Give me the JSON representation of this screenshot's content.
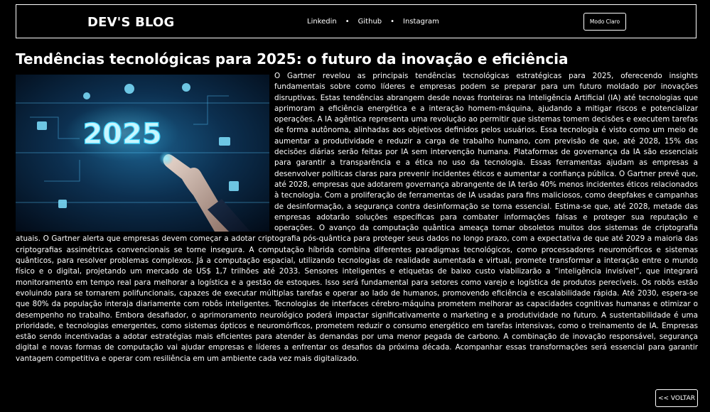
{
  "header": {
    "brand": "DEV'S BLOG",
    "nav": {
      "linkedin": "Linkedin",
      "github": "Github",
      "instagram": "Instagram",
      "separator": "•"
    },
    "mode_button": "Modo Claro"
  },
  "article": {
    "title": "Tendências tecnológicas para 2025: o futuro da inovação e eficiência",
    "image_text": "2025",
    "body": "O Gartner revelou as principais tendências tecnológicas estratégicas para 2025, oferecendo insights fundamentais sobre como líderes e empresas podem se preparar para um futuro moldado por inovações disruptivas. Estas tendências abrangem desde novas fronteiras na Inteligência Artificial (IA) até tecnologias que aprimoram a eficiência energética e a interação homem-máquina, ajudando a mitigar riscos e potencializar operações. A IA agêntica representa uma revolução ao permitir que sistemas tomem decisões e executem tarefas de forma autônoma, alinhadas aos objetivos definidos pelos usuários. Essa tecnologia é visto como um meio de aumentar a produtividade e reduzir a carga de trabalho humano, com previsão de que, até 2028, 15% das decisões diárias serão feitas por IA sem intervenção humana. Plataformas de governança da IA são essenciais para garantir a transparência e a ética no uso da tecnologia. Essas ferramentas ajudam as empresas a desenvolver políticas claras para prevenir incidentes éticos e aumentar a confiança pública. O Gartner prevê que, até 2028, empresas que adotarem governança abrangente de IA terão 40% menos incidentes éticos relacionados à tecnologia. Com a proliferação de ferramentas de IA usadas para fins maliciosos, como deepfakes e campanhas de desinformação, a segurança contra desinformação se torna essencial. Estima-se que, até 2028, metade das empresas adotarão soluções específicas para combater informações falsas e proteger sua reputação e operações. O avanço da computação quântica ameaça tornar obsoletos muitos dos sistemas de criptografia atuais. O Gartner alerta que empresas devem começar a adotar criptografia pós-quântica para proteger seus dados no longo prazo, com a expectativa de que até 2029 a maioria das criptografias assimétricas convencionais se torne insegura. A computação híbrida combina diferentes paradigmas tecnológicos, como processadores neuromórficos e sistemas quânticos, para resolver problemas complexos. Já a computação espacial, utilizando tecnologias de realidade aumentada e virtual, promete transformar a interação entre o mundo físico e o digital, projetando um mercado de US$ 1,7 trilhões até 2033. Sensores inteligentes e etiquetas de baixo custo viabilizarão a “inteligência invisível”, que integrará monitoramento em tempo real para melhorar a logística e a gestão de estoques. Isso será fundamental para setores como varejo e logística de produtos perecíveis. Os robôs estão evoluindo para se tornarem polifuncionais, capazes de executar múltiplas tarefas e operar ao lado de humanos, promovendo eficiência e escalabilidade rápida. Até 2030, espera-se que 80% da população interaja diariamente com robôs inteligentes. Tecnologias de interfaces cérebro-máquina prometem melhorar as capacidades cognitivas humanas e otimizar o desempenho no trabalho. Embora desafiador, o aprimoramento neurológico poderá impactar significativamente o marketing e a produtividade no futuro. A sustentabilidade é uma prioridade, e tecnologias emergentes, como sistemas ópticos e neuromórficos, prometem reduzir o consumo energético em tarefas intensivas, como o treinamento de IA. Empresas estão sendo incentivadas a adotar estratégias mais eficientes para atender às demandas por uma menor pegada de carbono. A combinação de inovação responsável, segurança digital e novas formas de computação vai ajudar empresas e líderes a enfrentar os desafios da próxima década. Acompanhar essas transformações será essencial para garantir vantagem competitiva e operar com resiliência em um ambiente cada vez mais digitalizado."
  },
  "footer": {
    "back_button": "<< VOLTAR"
  },
  "colors": {
    "background": "#000000",
    "text": "#ffffff",
    "image_glow": "#3ad6ff"
  }
}
